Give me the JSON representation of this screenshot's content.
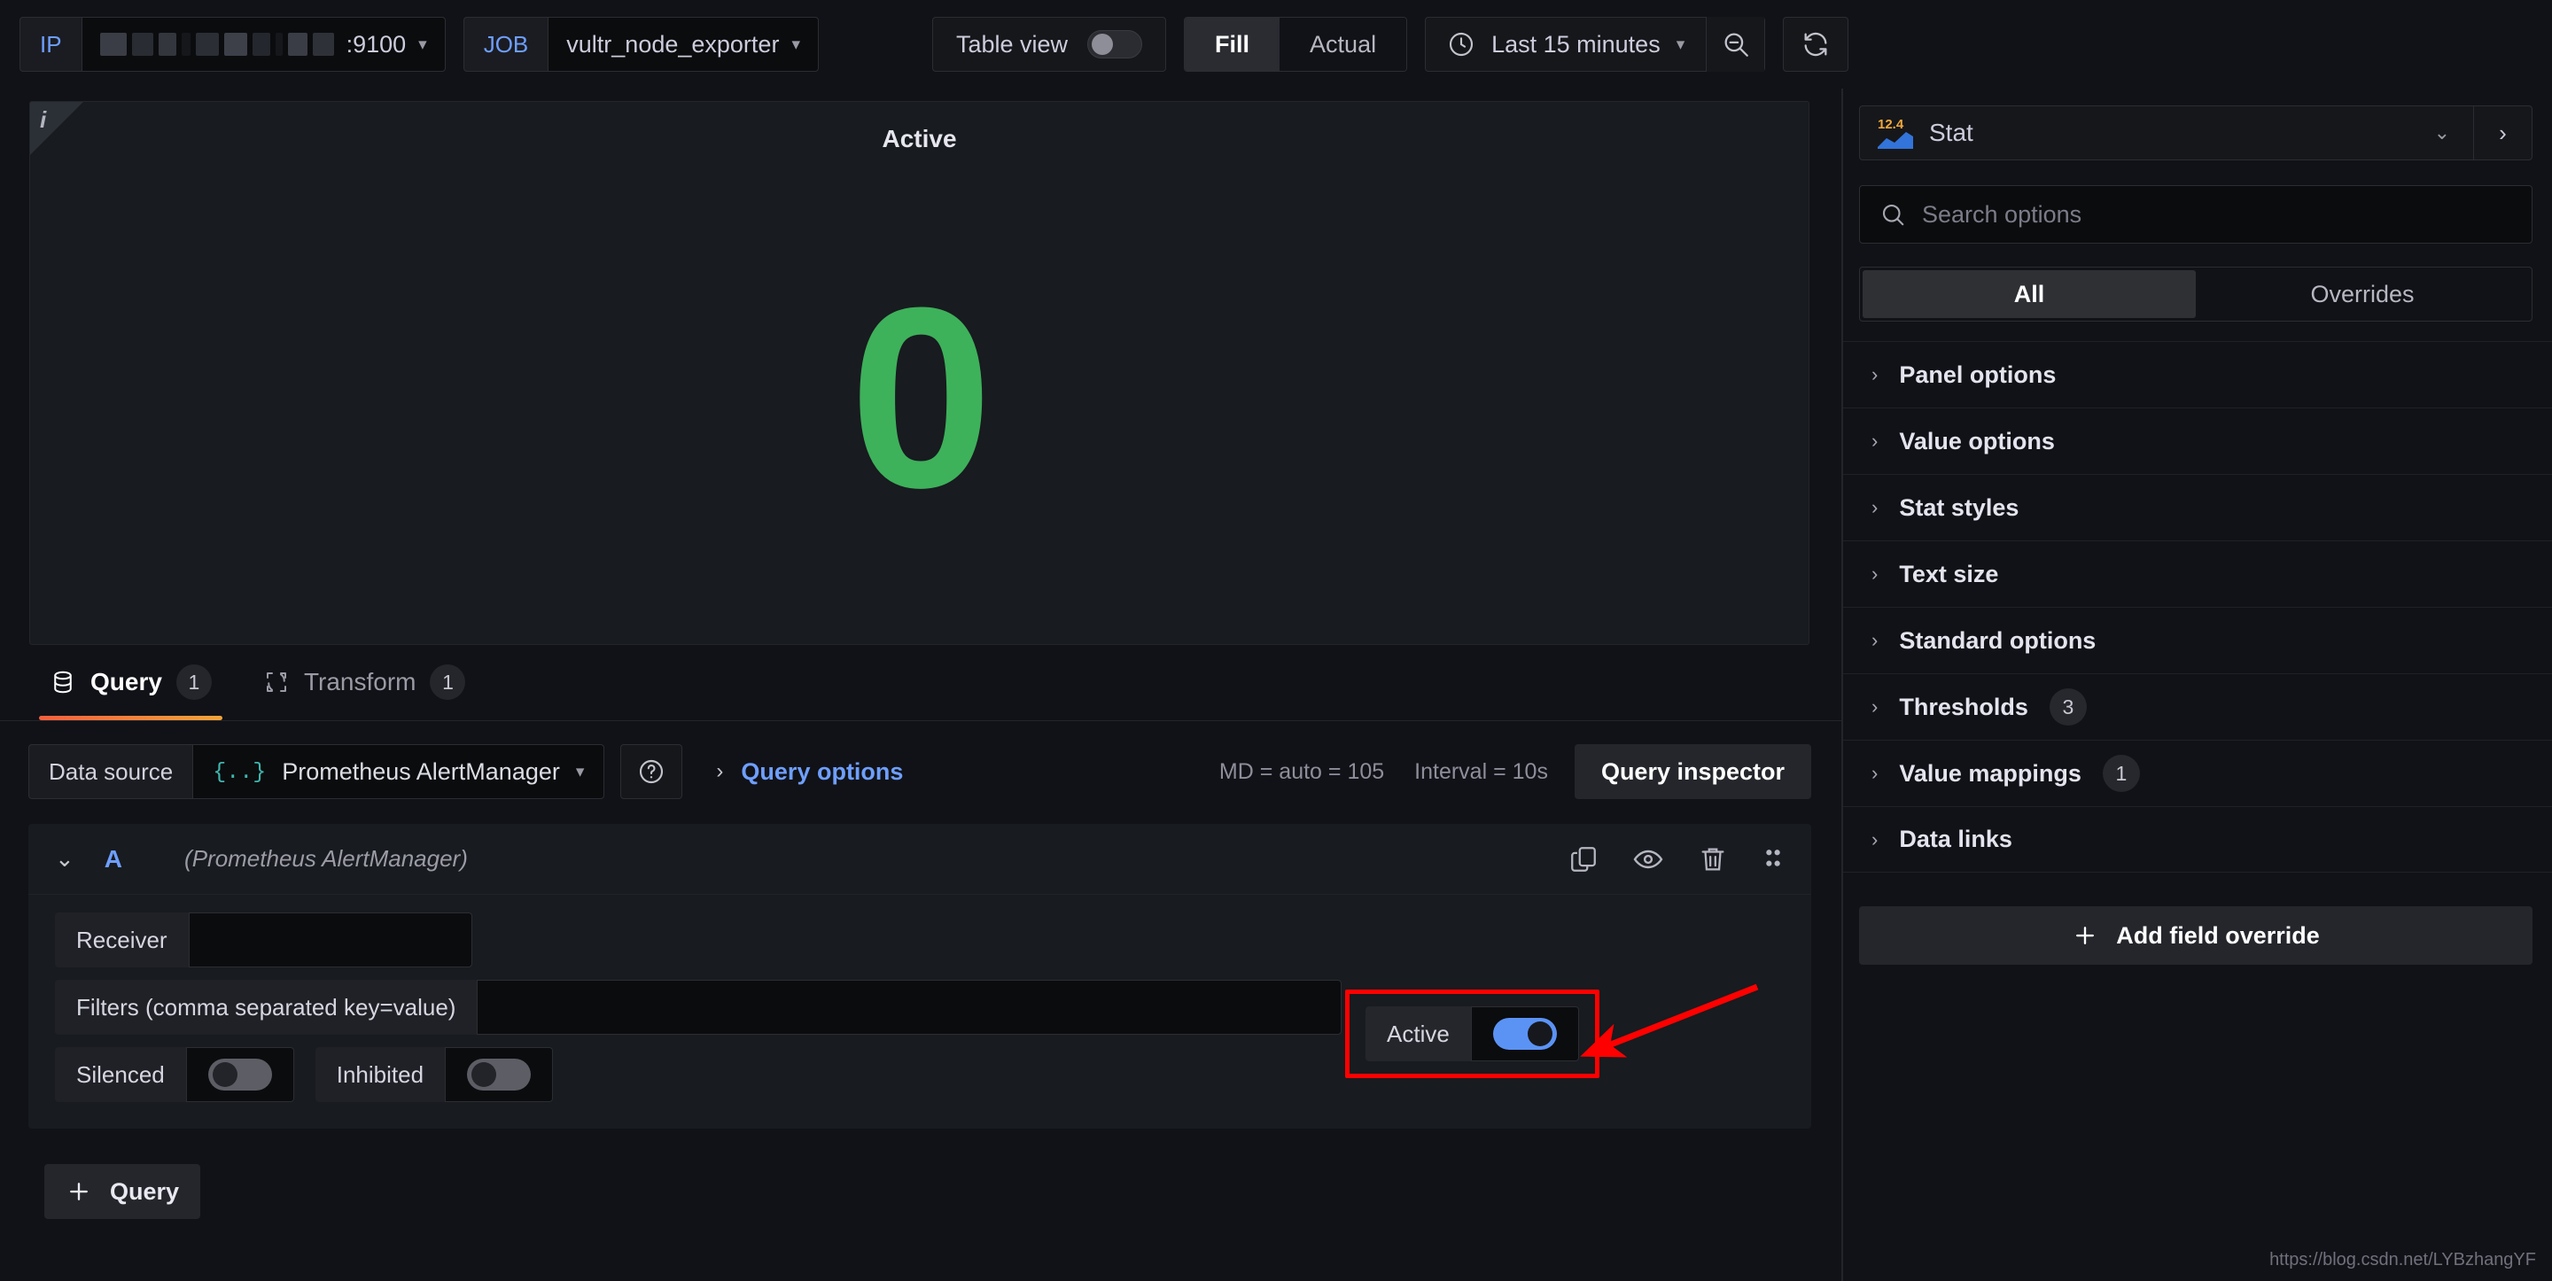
{
  "toolbar": {
    "ip_var": {
      "label": "IP",
      "value_suffix": ":9100",
      "redacted": true
    },
    "job_var": {
      "label": "JOB",
      "value": "vultr_node_exporter"
    },
    "table_view": {
      "label": "Table view",
      "enabled": false
    },
    "fit_mode": {
      "options": [
        "Fill",
        "Actual"
      ],
      "selected": "Fill"
    },
    "time_range": {
      "label": "Last 15 minutes",
      "icon": "clock-icon"
    },
    "zoom_out": {
      "icon": "zoom-out-icon"
    },
    "refresh": {
      "icon": "refresh-icon"
    }
  },
  "panel": {
    "title": "Active",
    "info_corner": "i",
    "stat_value": "0",
    "stat_color": "#3eb15b"
  },
  "tabs": [
    {
      "id": "query",
      "label": "Query",
      "count": "1",
      "icon": "database-icon",
      "active": true
    },
    {
      "id": "transform",
      "label": "Transform",
      "count": "1",
      "icon": "transform-icon",
      "active": false
    }
  ],
  "query_editor": {
    "datasource_label": "Data source",
    "datasource_value": "Prometheus AlertManager",
    "datasource_icon": "braces-icon",
    "help_icon": "question-circle-icon",
    "query_options_label": "Query options",
    "max_data_points": "MD = auto = 105",
    "interval": "Interval = 10s",
    "query_inspector": "Query inspector",
    "add_query_label": "Query",
    "query_row": {
      "ref_id": "A",
      "datasource_note": "(Prometheus AlertManager)",
      "actions": [
        "copy-icon",
        "eye-icon",
        "trash-icon",
        "drag-handle-icon"
      ],
      "fields": {
        "receiver_label": "Receiver",
        "receiver_value": "",
        "filters_label": "Filters (comma separated key=value)",
        "filters_value": "",
        "silenced_label": "Silenced",
        "silenced_on": false,
        "inhibited_label": "Inhibited",
        "inhibited_on": false,
        "active_label": "Active",
        "active_on": true
      }
    }
  },
  "options_pane": {
    "viz_name": "Stat",
    "viz_icon_value": "12.4",
    "search_placeholder": "Search options",
    "search_value": "",
    "filter_tabs": {
      "options": [
        "All",
        "Overrides"
      ],
      "selected": "All"
    },
    "sections": [
      {
        "label": "Panel options",
        "badge": ""
      },
      {
        "label": "Value options",
        "badge": ""
      },
      {
        "label": "Stat styles",
        "badge": ""
      },
      {
        "label": "Text size",
        "badge": ""
      },
      {
        "label": "Standard options",
        "badge": ""
      },
      {
        "label": "Thresholds",
        "badge": "3"
      },
      {
        "label": "Value mappings",
        "badge": "1"
      },
      {
        "label": "Data links",
        "badge": ""
      }
    ],
    "add_field_override": "Add field override"
  },
  "annotation": {
    "highlight_color": "#ff0000",
    "target": "active-toggle"
  },
  "watermark": "https://blog.csdn.net/LYBzhangYF"
}
